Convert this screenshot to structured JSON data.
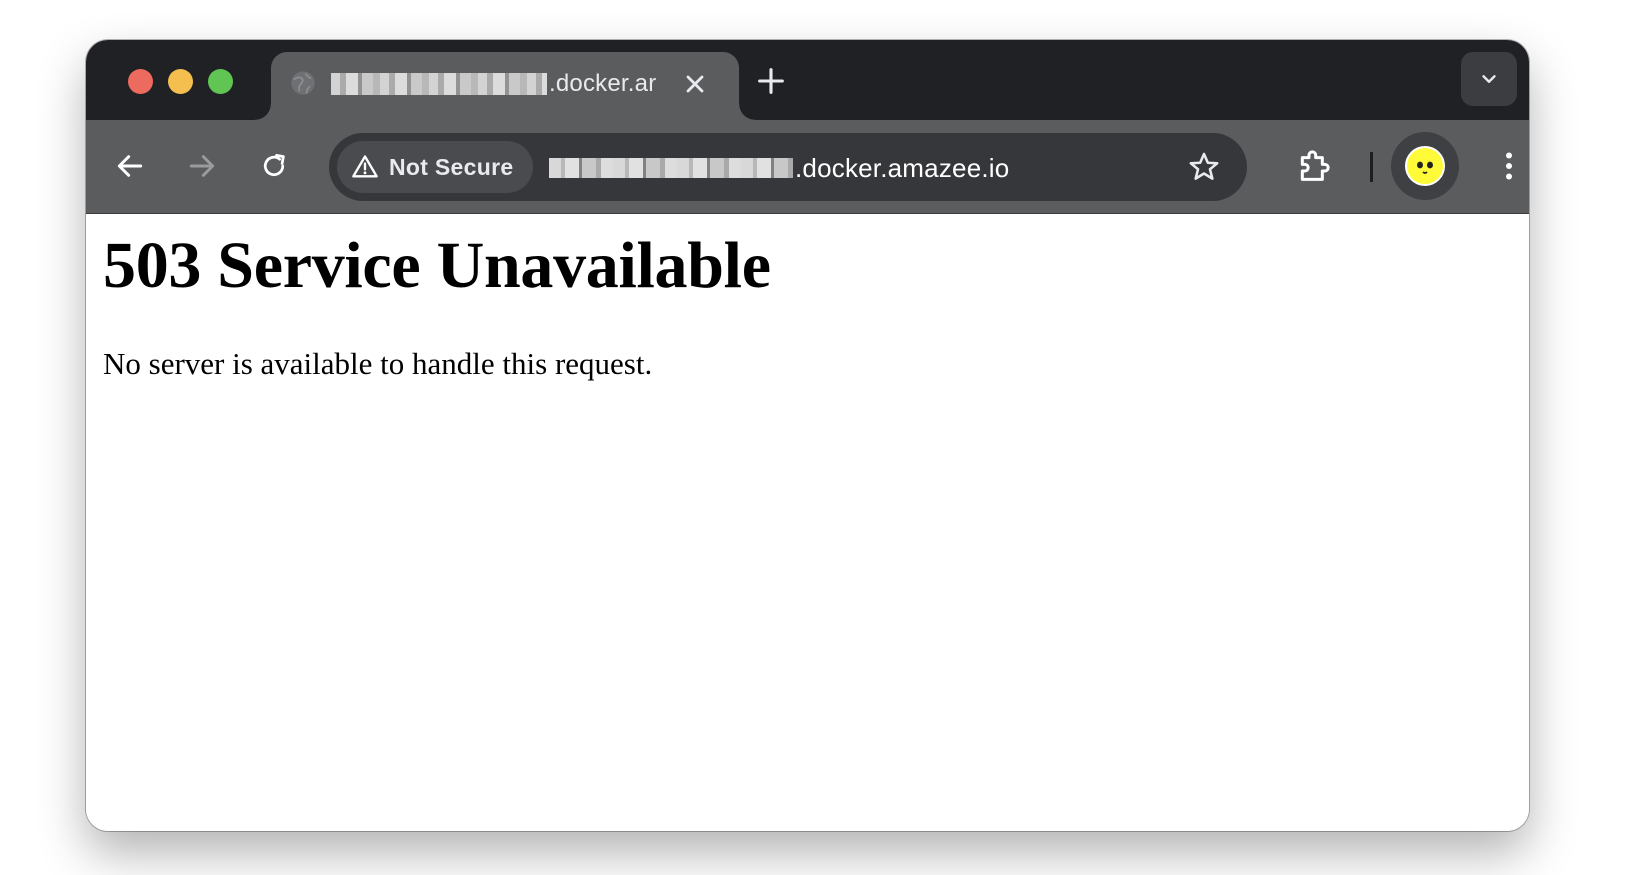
{
  "browser": {
    "tab": {
      "title_visible": ".docker.ar",
      "favicon": "globe-icon"
    },
    "toolbar": {
      "security_label": "Not Secure",
      "url_visible": ".docker.amazee.io"
    },
    "icons": {
      "back": "arrow-left-icon",
      "forward": "arrow-right-icon",
      "reload": "reload-icon",
      "warning": "warning-triangle-icon",
      "bookmark": "star-icon",
      "extensions": "puzzle-icon",
      "menu": "vertical-dots-icon",
      "close_tab": "close-icon",
      "new_tab": "plus-icon",
      "tab_search": "chevron-down-icon"
    },
    "colors": {
      "tabstrip": "#202124",
      "toolbar": "#5b5c5e",
      "traffic_close": "#ed6a5e",
      "traffic_minimize": "#f4bf4f",
      "traffic_maximize": "#61c554",
      "avatar": "#fffb39"
    }
  },
  "page": {
    "heading": "503 Service Unavailable",
    "message": "No server is available to handle this request."
  }
}
